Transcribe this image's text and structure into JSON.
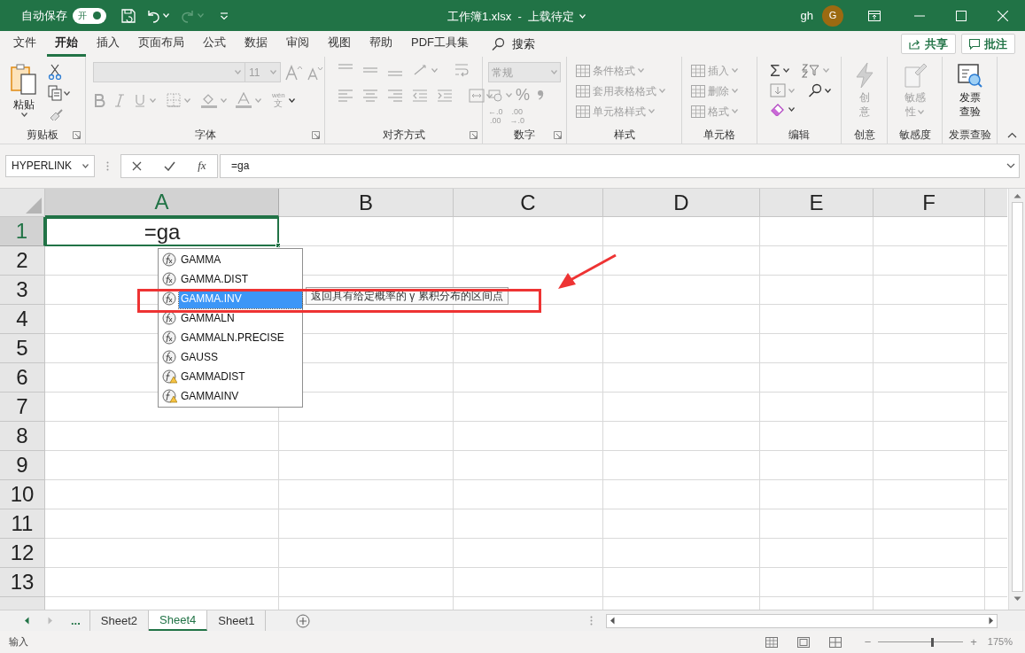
{
  "title_bar": {
    "autosave_label": "自动保存",
    "autosave": {
      "label": "开",
      "on": true
    },
    "redo_disabled": true,
    "file_title": "工作簿1.xlsx  -  上载待定",
    "user_name": "gh",
    "avatar_initial": "G"
  },
  "menu_tabs": [
    {
      "label": "文件",
      "selected": false
    },
    {
      "label": "开始",
      "selected": true
    },
    {
      "label": "插入",
      "selected": false
    },
    {
      "label": "页面布局",
      "selected": false
    },
    {
      "label": "公式",
      "selected": false
    },
    {
      "label": "数据",
      "selected": false
    },
    {
      "label": "审阅",
      "selected": false
    },
    {
      "label": "视图",
      "selected": false
    },
    {
      "label": "帮助",
      "selected": false
    },
    {
      "label": "PDF工具集",
      "selected": false
    }
  ],
  "search_label": "搜索",
  "share_button": "共享",
  "comments_button": "批注",
  "ribbon_groups": [
    {
      "kind": "clipboard",
      "label": "剪贴板",
      "paste_label": "粘贴",
      "launcher": true
    },
    {
      "kind": "font",
      "label": "字体",
      "font_size": "11",
      "phonetic_top": "wén",
      "phonetic_bottom": "文",
      "disabled": true,
      "launcher": true
    },
    {
      "kind": "alignment",
      "label": "对齐方式",
      "disabled": true,
      "launcher": true
    },
    {
      "kind": "number",
      "label": "数字",
      "format": "常规",
      "percent": "%",
      "decimals": [
        {
          "top": "←.0",
          "bottom": ".00"
        },
        {
          "top": ".00",
          "bottom": "→.0"
        }
      ],
      "disabled": true,
      "launcher": true
    },
    {
      "kind": "list",
      "label": "样式",
      "launcher": false,
      "items": [
        {
          "label": "条件格式",
          "disabled": true
        },
        {
          "label": "套用表格格式",
          "disabled": true
        },
        {
          "label": "单元格样式",
          "disabled": true
        }
      ]
    },
    {
      "kind": "list",
      "label": "单元格",
      "launcher": false,
      "items": [
        {
          "label": "插入",
          "disabled": true
        },
        {
          "label": "删除",
          "disabled": true
        },
        {
          "label": "格式",
          "disabled": true
        }
      ]
    },
    {
      "kind": "editing",
      "label": "编辑",
      "sum_symbol": "Σ",
      "launcher": false
    },
    {
      "kind": "big_button",
      "label": "创意",
      "button_lines": [
        "创",
        "意"
      ],
      "disabled": true,
      "dropdown": false,
      "launcher": false
    },
    {
      "kind": "big_button",
      "label": "敏感度",
      "button_lines": [
        "敏感",
        "性"
      ],
      "disabled": true,
      "dropdown": true,
      "launcher": false
    },
    {
      "kind": "big_button",
      "label": "发票查验",
      "button_lines": [
        "发票",
        "查验"
      ],
      "disabled": false,
      "dropdown": false,
      "launcher": false
    }
  ],
  "formula_bar": {
    "name_box": "HYPERLINK",
    "fx_label": "fx",
    "formula": "=ga"
  },
  "grid": {
    "columns": [
      {
        "label": "A",
        "selected": true
      },
      {
        "label": "B",
        "selected": false
      },
      {
        "label": "C",
        "selected": false
      },
      {
        "label": "D",
        "selected": false
      },
      {
        "label": "E",
        "selected": false
      },
      {
        "label": "F",
        "selected": false
      }
    ],
    "rows": [
      {
        "label": "1",
        "selected": true,
        "first_cell": "=ga"
      },
      {
        "label": "2",
        "selected": false
      },
      {
        "label": "3",
        "selected": false
      },
      {
        "label": "4",
        "selected": false
      },
      {
        "label": "5",
        "selected": false
      },
      {
        "label": "6",
        "selected": false
      },
      {
        "label": "7",
        "selected": false
      },
      {
        "label": "8",
        "selected": false
      },
      {
        "label": "9",
        "selected": false
      },
      {
        "label": "10",
        "selected": false
      },
      {
        "label": "11",
        "selected": false
      },
      {
        "label": "12",
        "selected": false
      },
      {
        "label": "13",
        "selected": false
      }
    ]
  },
  "autocomplete": {
    "items": [
      {
        "label": "GAMMA",
        "kind": "function",
        "selected": false
      },
      {
        "label": "GAMMA.DIST",
        "kind": "function",
        "selected": false
      },
      {
        "label": "GAMMA.INV",
        "kind": "function",
        "selected": true
      },
      {
        "label": "GAMMALN",
        "kind": "function",
        "selected": false
      },
      {
        "label": "GAMMALN.PRECISE",
        "kind": "function",
        "selected": false
      },
      {
        "label": "GAUSS",
        "kind": "function",
        "selected": false
      },
      {
        "label": "GAMMADIST",
        "kind": "compatibility",
        "selected": false
      },
      {
        "label": "GAMMAINV",
        "kind": "compatibility",
        "selected": false
      }
    ],
    "tooltip": "返回具有给定概率的 γ 累积分布的区间点"
  },
  "sheet_tabs": {
    "overflow": "...",
    "tabs": [
      {
        "label": "Sheet2",
        "selected": false
      },
      {
        "label": "Sheet4",
        "selected": true
      },
      {
        "label": "Sheet1",
        "selected": false
      }
    ]
  },
  "status_bar": {
    "mode": "输入",
    "zoom_out": "−",
    "zoom_in": "+",
    "zoom": "175%",
    "zoom_slider": {
      "level": 0.62
    }
  }
}
